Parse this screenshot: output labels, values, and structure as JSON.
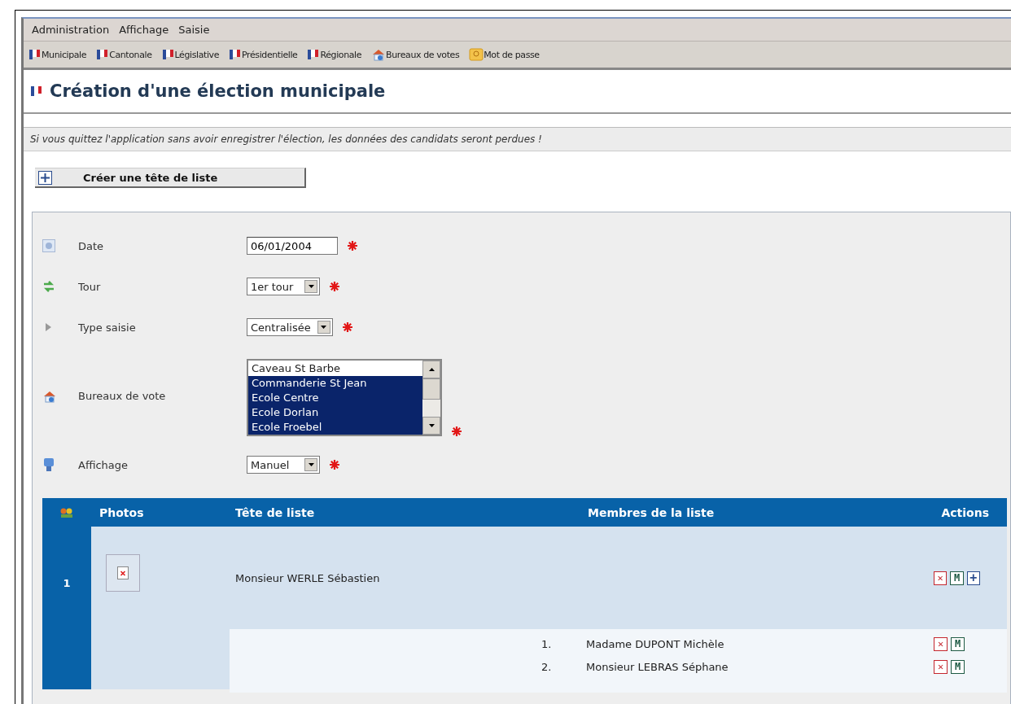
{
  "menu": [
    "Administration",
    "Affichage",
    "Saisie"
  ],
  "toolbar": [
    {
      "label": "Municipale",
      "kind": "flag"
    },
    {
      "label": "Cantonale",
      "kind": "flag"
    },
    {
      "label": "Législative",
      "kind": "flag"
    },
    {
      "label": "Présidentielle",
      "kind": "flag"
    },
    {
      "label": "Régionale",
      "kind": "flag"
    },
    {
      "label": "Bureaux de votes",
      "kind": "house"
    },
    {
      "label": "Mot de passe",
      "kind": "key"
    }
  ],
  "page_title": "Création d'une élection municipale",
  "notice": "Si vous quittez l'application sans avoir enregistrer l'élection, les données des candidats seront perdues !",
  "create_button": "Créer une tête de liste",
  "form": [
    {
      "label": "Date",
      "kind": "text",
      "value": "06/01/2004",
      "required": true
    },
    {
      "label": "Tour",
      "kind": "select",
      "value": "1er tour",
      "required": true
    },
    {
      "label": "Type saisie",
      "kind": "select",
      "value": "Centralisée",
      "required": true
    },
    {
      "label": "Bureaux de vote",
      "kind": "listbox",
      "required": true,
      "options": [
        {
          "label": "Caveau St Barbe",
          "selected": false
        },
        {
          "label": "Commanderie St Jean",
          "selected": true
        },
        {
          "label": "Ecole Centre",
          "selected": true
        },
        {
          "label": "Ecole Dorlan",
          "selected": true
        },
        {
          "label": "Ecole Froebel",
          "selected": true
        }
      ]
    },
    {
      "label": "Affichage",
      "kind": "select",
      "value": "Manuel",
      "required": true
    }
  ],
  "table": {
    "columns": [
      "Photos",
      "Tête de liste",
      "Membres de la liste",
      "Actions"
    ],
    "rows": [
      {
        "number": "1",
        "head": "Monsieur WERLE Sébastien",
        "actions": [
          {
            "kind": "delete",
            "glyph": "✕"
          },
          {
            "kind": "modify",
            "glyph": "M"
          },
          {
            "kind": "add",
            "glyph": "+"
          }
        ],
        "members": [
          {
            "number": "1.",
            "name": "Madame DUPONT Michèle",
            "actions": [
              {
                "kind": "delete",
                "glyph": "✕"
              },
              {
                "kind": "modify",
                "glyph": "M"
              }
            ]
          },
          {
            "number": "2.",
            "name": "Monsieur LEBRAS Séphane",
            "actions": [
              {
                "kind": "delete",
                "glyph": "✕"
              },
              {
                "kind": "modify",
                "glyph": "M"
              }
            ]
          }
        ]
      }
    ]
  }
}
